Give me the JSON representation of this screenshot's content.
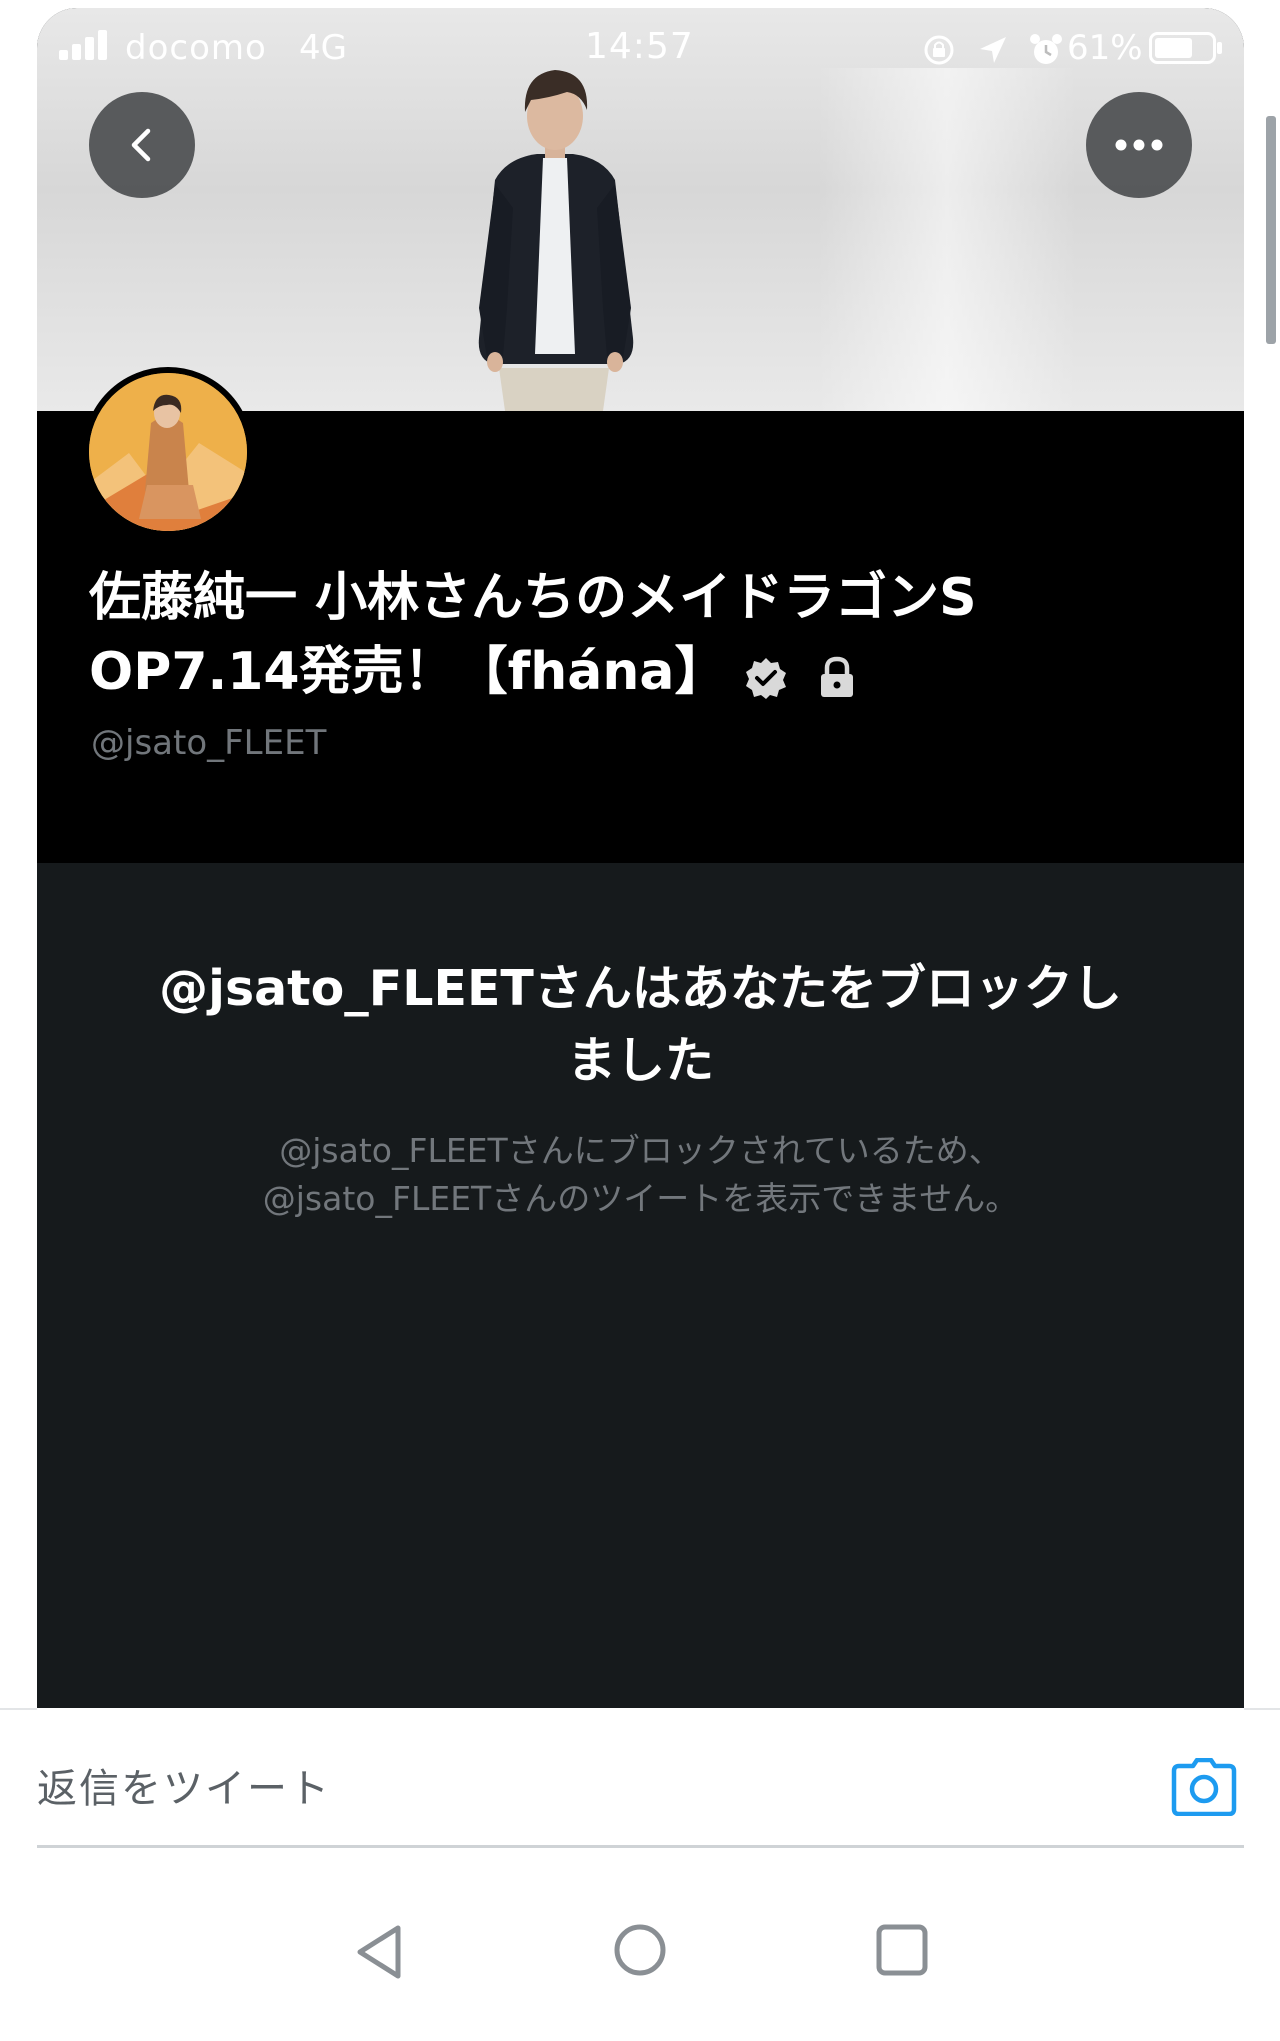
{
  "status_bar": {
    "carrier": "docomo",
    "network": "4G",
    "time": "14:57",
    "battery": "61%",
    "icons": [
      "signal-icon",
      "rotation-lock-icon",
      "location-icon",
      "alarm-icon",
      "battery-icon"
    ]
  },
  "header": {
    "back_icon": "chevron-left-icon",
    "more_icon": "more-horizontal-icon"
  },
  "profile": {
    "display_name": "佐藤純一 小林さんちのメイドラゴンS OP7.14発売！【fhána】",
    "handle": "@jsato_FLEET",
    "badges": [
      "verified-icon",
      "lock-icon"
    ]
  },
  "blocked": {
    "title": "@jsato_FLEETさんはあなたをブロックしました",
    "description_line1": "@jsato_FLEETさんにブロックされているため、",
    "description_line2": "@jsato_FLEETさんのツイートを表示できません。"
  },
  "reply_bar": {
    "placeholder": "返信をツイート",
    "camera_icon": "camera-icon"
  },
  "colors": {
    "profile_bg": "#000000",
    "blocked_bg": "#161a1c",
    "accent": "#1d9bf0",
    "muted_text": "#71767b"
  },
  "nav_bar": {
    "icons": [
      "nav-back-icon",
      "nav-home-icon",
      "nav-recent-icon"
    ]
  }
}
